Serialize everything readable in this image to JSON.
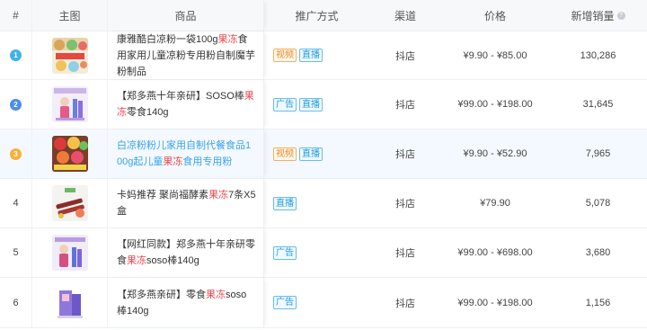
{
  "columns": {
    "index": "#",
    "image": "主图",
    "product": "商品",
    "promotion": "推广方式",
    "channel": "渠道",
    "price": "价格",
    "new_sales": "新增销量"
  },
  "rows": [
    {
      "index": "1",
      "title_parts": [
        "康雅酷白凉粉一袋100g",
        "果冻",
        "食用家用儿童凉粉专用粉自制魔芋粉制品"
      ],
      "promotion_tags": [
        "视频",
        "直播"
      ],
      "channel": "抖店",
      "price": "¥9.90 - ¥85.00",
      "new_sales": "130,286"
    },
    {
      "index": "2",
      "title_parts": [
        "【郑多燕十年亲研】SOSO棒",
        "果冻",
        "零食140g"
      ],
      "promotion_tags": [
        "广告",
        "直播"
      ],
      "channel": "抖店",
      "price": "¥99.00 - ¥198.00",
      "new_sales": "31,645"
    },
    {
      "index": "3",
      "title_parts": [
        "白凉粉粉儿家用自制代餐食品100g起儿童",
        "果冻",
        "食用专用粉"
      ],
      "promotion_tags": [
        "视频",
        "直播"
      ],
      "channel": "抖店",
      "price": "¥9.90 - ¥52.90",
      "new_sales": "7,965"
    },
    {
      "index": "4",
      "title_parts": [
        "卡妈推荐 聚尚福酵素",
        "果冻",
        "7条X5盒"
      ],
      "promotion_tags": [
        "直播"
      ],
      "channel": "抖店",
      "price": "¥79.90",
      "new_sales": "5,078"
    },
    {
      "index": "5",
      "title_parts": [
        "【网红同款】郑多燕十年亲研零食",
        "果冻",
        "soso棒140g"
      ],
      "promotion_tags": [
        "广告"
      ],
      "channel": "抖店",
      "price": "¥99.00 - ¥698.00",
      "new_sales": "3,680"
    },
    {
      "index": "6",
      "title_parts": [
        "【郑多燕亲研】零食",
        "果冻",
        "soso棒140g"
      ],
      "promotion_tags": [
        "广告"
      ],
      "channel": "抖店",
      "price": "¥99.00 - ¥198.00",
      "new_sales": "1,156"
    }
  ],
  "colors": {
    "keyword": "#e8474f",
    "link": "#3aa3e8",
    "tag_video": "#ea8a1e",
    "tag_blue": "#1f9be0",
    "rank1": "#3eb3e8",
    "rank2": "#4a8df0",
    "rank3": "#f6b13a"
  },
  "icons": {
    "help": "question-circle-icon"
  }
}
